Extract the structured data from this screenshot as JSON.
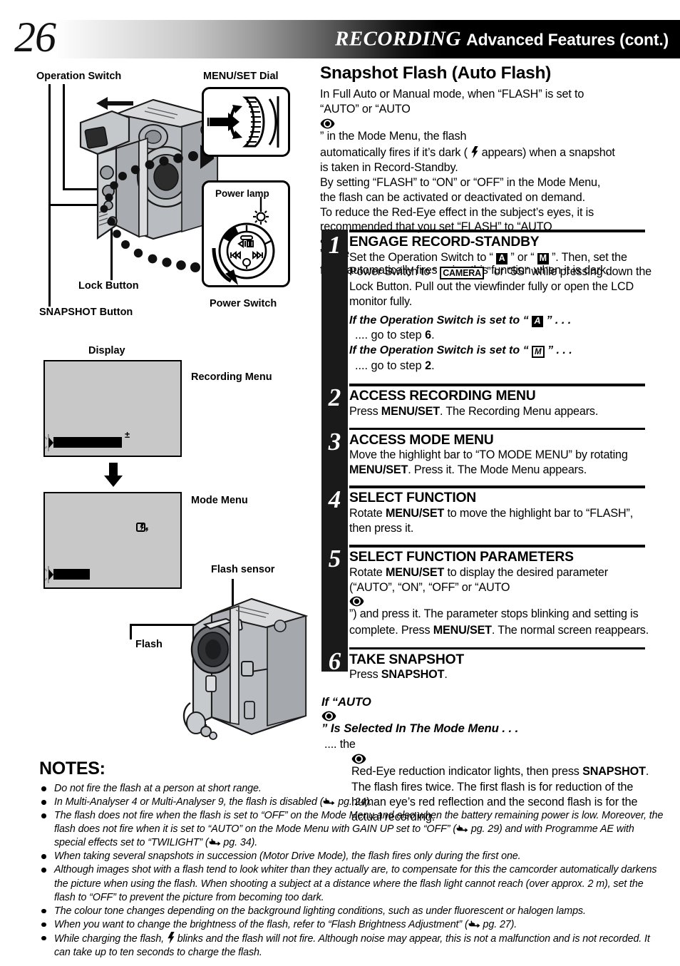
{
  "header": {
    "page_number": "26",
    "title_main": "RECORDING",
    "title_sub": "Advanced Features (cont.)"
  },
  "illustration": {
    "labels": {
      "operation_switch": "Operation Switch",
      "menu_set_dial": "MENU/SET Dial",
      "power_lamp": "Power lamp",
      "power_switch": "Power Switch",
      "lock_button": "Lock Button",
      "snapshot_button": "SNAPSHOT Button",
      "display": "Display",
      "recording_menu": "Recording Menu",
      "mode_menu": "Mode Menu",
      "flash_sensor": "Flash sensor",
      "flash": "Flash"
    },
    "icons": {
      "camcorder_body": "camcorder-icon",
      "menu_dial": "menu-set-dial-icon",
      "power_dial": "power-switch-dial-icon",
      "down_arrow": "down-arrow-icon",
      "flash_unit": "camcorder-flash-icon"
    }
  },
  "main": {
    "section_title": "Snapshot Flash (Auto Flash)",
    "intro_lines": [
      "In Full Auto or Manual mode, when “FLASH” is set to",
      "“AUTO” or “AUTO ",
      "” in the Mode Menu, the flash",
      "automatically fires if it’s dark ( ",
      " appears) when a snapshot",
      "is taken in Record-Standby.",
      "By setting “FLASH” to “ON” or “OFF” in the Mode Menu,",
      "the flash can be activated or deactivated on demand.",
      "To reduce the Red-Eye effect in the subject’s eyes, it is",
      "recommended that you set “FLASH” to “AUTO ",
      "”. The",
      "flash automatically fires using this function when it is dark."
    ]
  },
  "steps": [
    {
      "number": "1",
      "heading": "ENGAGE RECORD-STANDBY",
      "body_a": "Set the Operation Switch to “ ",
      "body_b": " ” or “ ",
      "body_c": " ”. Then, set the Power Switch to “ ",
      "body_d": " ” or “5S” while pressing down the Lock Button. Pull out the viewfinder fully or open the LCD monitor fully.",
      "icon_a": "A",
      "icon_m": "M",
      "icon_camera": "CAMERA",
      "sub1_head_a": "If the Operation Switch is set to “ ",
      "sub1_head_b": " ” . . .",
      "sub1_line": ".... go to step ",
      "sub1_step": "6",
      "sub2_head_a": "If the Operation Switch is set to “ ",
      "sub2_head_b": " ” . . .",
      "sub2_line": ".... go to step ",
      "sub2_step": "2"
    },
    {
      "number": "2",
      "heading": "ACCESS RECORDING MENU",
      "body_a": "Press ",
      "bold_1": "MENU/SET",
      "body_b": ". The Recording Menu appears."
    },
    {
      "number": "3",
      "heading": "ACCESS MODE MENU",
      "body_a": "Move the highlight bar to “TO MODE MENU” by rotating ",
      "bold_1": "MENU/SET",
      "body_b": ". Press it. The Mode Menu appears."
    },
    {
      "number": "4",
      "heading": "SELECT FUNCTION",
      "body_a": "Rotate ",
      "bold_1": "MENU/SET",
      "body_b": " to move the highlight bar to “FLASH”, then press it."
    },
    {
      "number": "5",
      "heading": "SELECT FUNCTION PARAMETERS",
      "body_a": "Rotate ",
      "bold_1": "MENU/SET",
      "body_b": " to display the desired parameter (“AUTO”, “ON”, “OFF” or “AUTO ",
      "body_c": "”) and press it. The parameter stops blinking and setting is complete. Press ",
      "bold_2": "MENU/SET",
      "body_d": ". The normal screen reappears."
    },
    {
      "number": "6",
      "heading": "TAKE SNAPSHOT",
      "body_a": "Press ",
      "bold_1": "SNAPSHOT",
      "body_b": "."
    }
  ],
  "if_auto": {
    "head_a": "If “AUTO ",
    "head_b": "” Is Selected In The Mode Menu . . .",
    "body_a": ".... the ",
    "body_b": " Red-Eye reduction indicator lights, then press ",
    "bold_1": "SNAPSHOT",
    "body_c": ". The flash fires twice. The first flash is for reduction of the human eye’s red reflection and the second flash is for the actual recording."
  },
  "notes": {
    "title": "NOTES:",
    "items": [
      {
        "parts": [
          "Do not fire the flash at a person at short range."
        ]
      },
      {
        "parts": [
          "In Multi-Analyser 4 or Multi-Analyser 9, the flash is disabled (",
          "HAND",
          " pg. 24)."
        ]
      },
      {
        "parts": [
          "The flash does not fire when the flash is set to “OFF” on the Mode Menu and also when the battery remaining power is low. Moreover, the flash does not fire when it is set to “AUTO” on the Mode Menu with GAIN UP set to “OFF” (",
          "HAND",
          " pg. 29) and with Programme AE with special effects set to “TWILIGHT” (",
          "HAND",
          " pg. 34)."
        ]
      },
      {
        "parts": [
          "When taking several snapshots in succession (Motor Drive Mode), the flash fires only during the first one."
        ]
      },
      {
        "parts": [
          "Although images shot with a flash tend to look whiter than they actually are, to compensate for this the camcorder automatically darkens the picture when using the flash. When shooting a subject at a distance where the flash light cannot reach (over approx. 2 m), set the flash to “OFF” to prevent the picture from becoming too dark."
        ]
      },
      {
        "parts": [
          "The colour tone changes depending on the background lighting conditions, such as under fluorescent or halogen lamps."
        ]
      },
      {
        "parts": [
          "When you want to change the brightness of the flash, refer to “Flash Brightness Adjustment” (",
          "HAND",
          " pg. 27)."
        ]
      },
      {
        "parts": [
          "While charging the flash, ",
          "BOLT",
          " blinks and the flash will not fire. Although noise may appear, this is not a malfunction and is not recorded. It can take up to ten seconds to charge the flash."
        ]
      }
    ]
  },
  "colors": {
    "header_dark": "#000000",
    "step_bar": "#1a1a1a",
    "lcd_gray": "#c8c8c8",
    "body_gray": "#a8acb0"
  }
}
